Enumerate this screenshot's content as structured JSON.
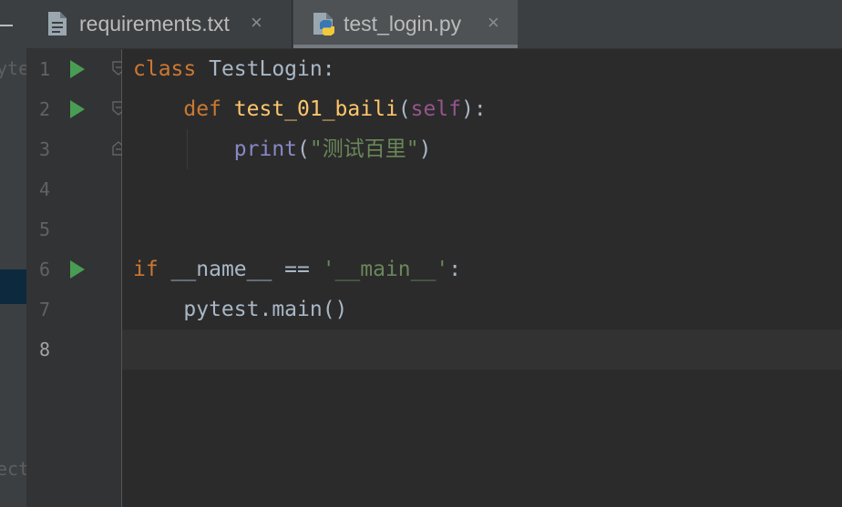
{
  "sidebar": {
    "cut_top": "yte",
    "cut_bottom": "ect"
  },
  "tabs": [
    {
      "label": "requirements.txt",
      "icon": "text-file-icon",
      "close": "×",
      "active": false
    },
    {
      "label": "test_login.py",
      "icon": "python-file-icon",
      "close": "×",
      "active": true
    }
  ],
  "gutter": {
    "line_numbers": [
      "1",
      "2",
      "3",
      "4",
      "5",
      "6",
      "7",
      "8"
    ],
    "current_line": "8",
    "run_icon": "run-gutter-icon",
    "fold_icon": "fold-marker-icon"
  },
  "code": {
    "line1": {
      "kw": "class",
      "name": " TestLogin",
      "colon": ":"
    },
    "line2": {
      "indent": "    ",
      "kw": "def",
      "fn": " test_01_baili",
      "open": "(",
      "self": "self",
      "close": "):"
    },
    "line3": {
      "indent": "        ",
      "builtin": "print",
      "open": "(",
      "str": "\"测试百里\"",
      "close": ")"
    },
    "line6": {
      "kw": "if",
      "rest": " __name__ == ",
      "str": "'__main__'",
      "colon": ":"
    },
    "line7": {
      "indent": "    ",
      "text": "pytest.main()"
    }
  },
  "colors": {
    "keyword": "#cc7832",
    "function": "#ffc66d",
    "self": "#94558d",
    "builtin": "#8888c6",
    "string": "#6a8759",
    "run": "#499c54",
    "background": "#2b2b2b"
  }
}
